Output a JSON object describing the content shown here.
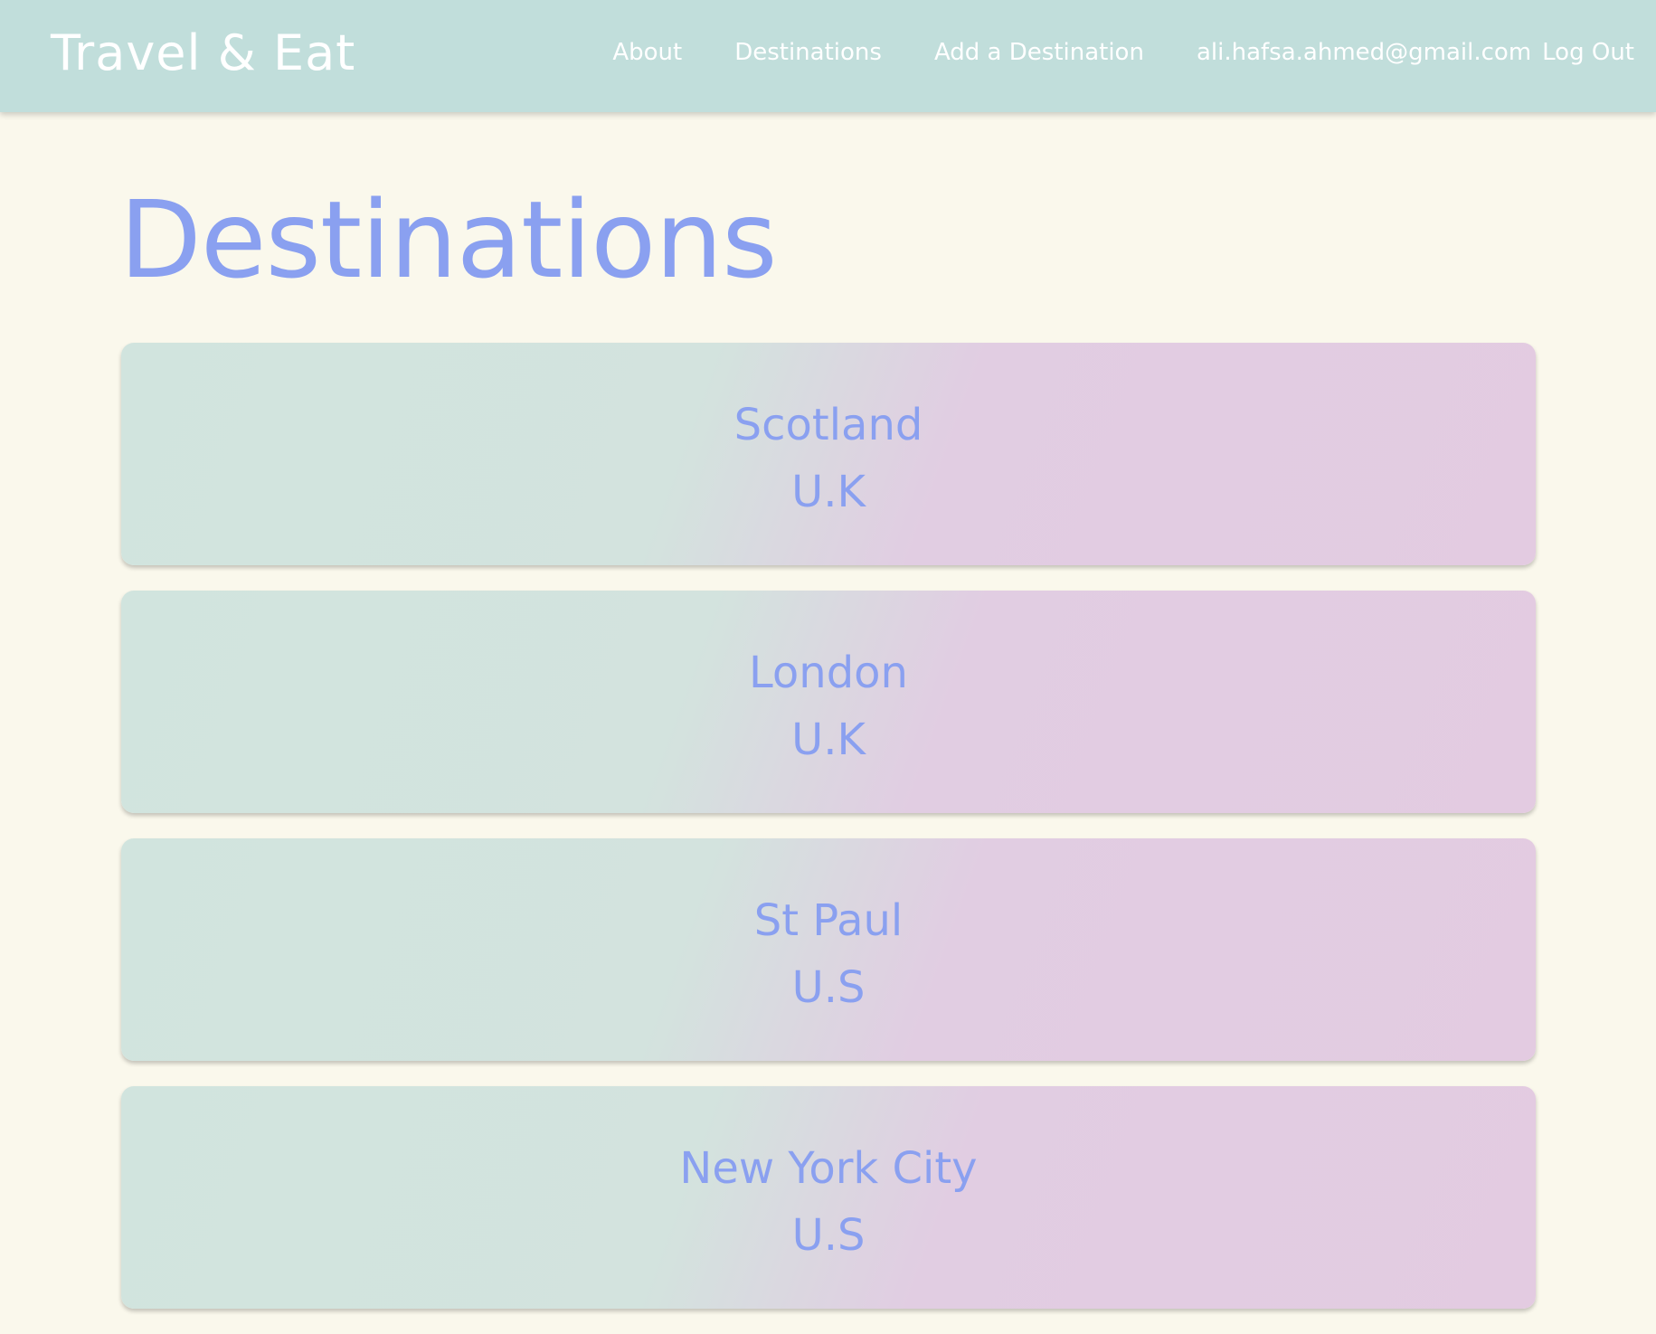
{
  "navbar": {
    "brand": "Travel & Eat",
    "links": {
      "about": "About",
      "destinations": "Destinations",
      "add": "Add a Destination"
    },
    "user_email": "ali.hafsa.ahmed@gmail.com",
    "logout": "Log Out"
  },
  "main": {
    "title": "Destinations",
    "destinations": [
      {
        "city": "Scotland",
        "country": "U.K"
      },
      {
        "city": "London",
        "country": "U.K"
      },
      {
        "city": "St Paul",
        "country": "U.S"
      },
      {
        "city": "New York City",
        "country": "U.S"
      }
    ]
  },
  "colors": {
    "navbar": "#c1dedb",
    "background": "#faf8ec",
    "accent_text": "#8aa0f0",
    "card_gradient_start": "#d1e4de",
    "card_gradient_end": "#e3cbe1"
  }
}
